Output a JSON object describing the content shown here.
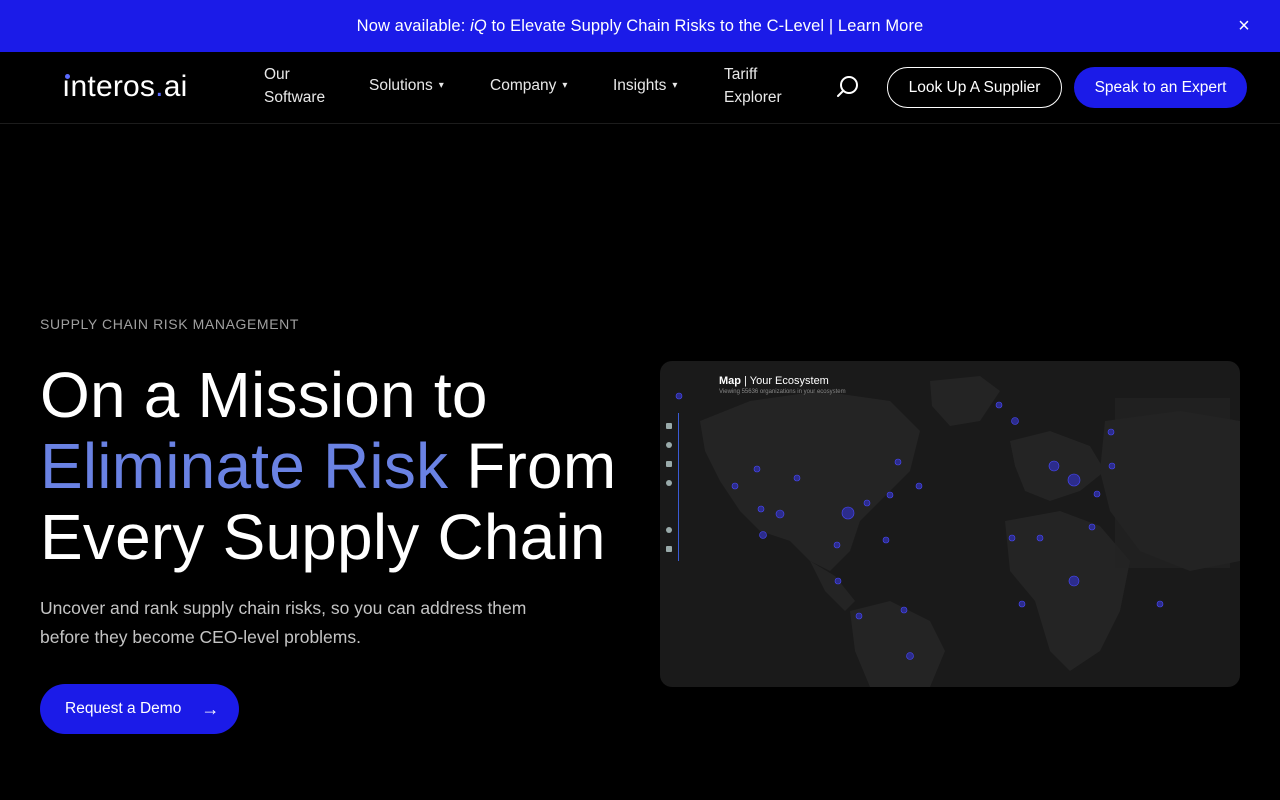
{
  "announcement": {
    "prefix": "Now available: ",
    "iq": "iQ",
    "suffix": " to Elevate Supply Chain Risks to the C-Level | Learn More",
    "close_icon": "close-icon"
  },
  "header": {
    "logo_main": "nteros",
    "logo_dot": ".",
    "logo_tail": "ai",
    "nav": {
      "our_software": "Our Software",
      "solutions": "Solutions",
      "company": "Company",
      "insights": "Insights",
      "tariff_explorer": "Tariff Explorer"
    },
    "caret": "▾",
    "search_icon": "search-icon",
    "lookup_label": "Look Up A Supplier",
    "expert_label": "Speak to an Expert"
  },
  "hero": {
    "eyebrow": "SUPPLY CHAIN RISK MANAGEMENT",
    "headline_line1": "On a Mission to",
    "headline_accent": "Eliminate Risk",
    "headline_line2_rest": " From",
    "headline_line3": "Every Supply Chain",
    "subtext": "Uncover and rank supply chain risks, so you can address them before they become CEO-level problems.",
    "cta_label": "Request a Demo",
    "cta_arrow": "→"
  },
  "map": {
    "title_bold": "Map",
    "title_rest": " | Your Ecosystem",
    "subtitle": "Viewing 55636 organizations in your ecosystem"
  },
  "colors": {
    "brand_blue": "#1b1be8",
    "accent": "#6a82e3"
  }
}
